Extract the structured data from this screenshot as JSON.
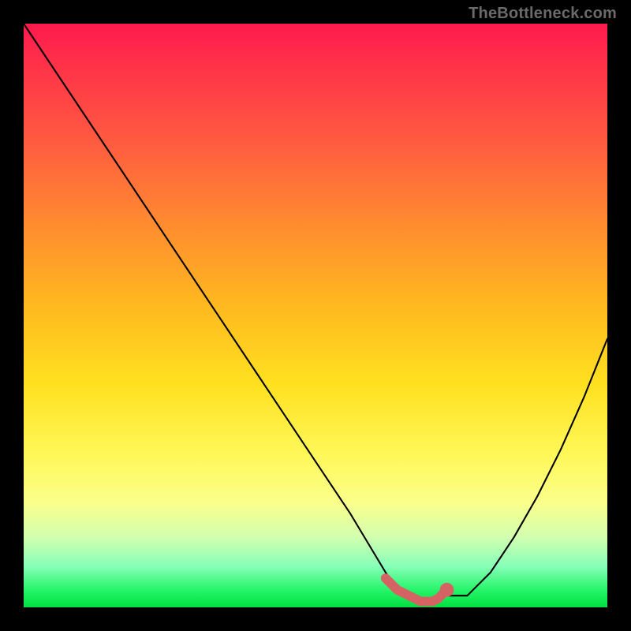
{
  "watermark": "TheBottleneck.com",
  "chart_data": {
    "type": "line",
    "title": "",
    "xlabel": "",
    "ylabel": "",
    "xlim": [
      0,
      100
    ],
    "ylim": [
      0,
      100
    ],
    "grid": false,
    "series": [
      {
        "name": "bottleneck-curve",
        "color": "#000000",
        "x": [
          0,
          8,
          16,
          24,
          32,
          40,
          48,
          56,
          62,
          64,
          67,
          70,
          72,
          76,
          80,
          84,
          88,
          92,
          96,
          100
        ],
        "values": [
          100,
          88,
          76,
          64,
          52,
          40,
          28,
          16,
          6,
          3,
          1,
          1,
          2,
          2,
          6,
          12,
          19,
          27,
          36,
          46
        ]
      },
      {
        "name": "optimal-segment",
        "color": "#d66363",
        "x": [
          62,
          64,
          66,
          68,
          70,
          71,
          72,
          72.5
        ],
        "values": [
          5,
          3,
          2,
          1,
          1,
          1.5,
          2.5,
          3
        ]
      }
    ],
    "annotations": [
      {
        "name": "optimal-dot",
        "x": 72.5,
        "y": 3,
        "color": "#d66363"
      }
    ]
  }
}
